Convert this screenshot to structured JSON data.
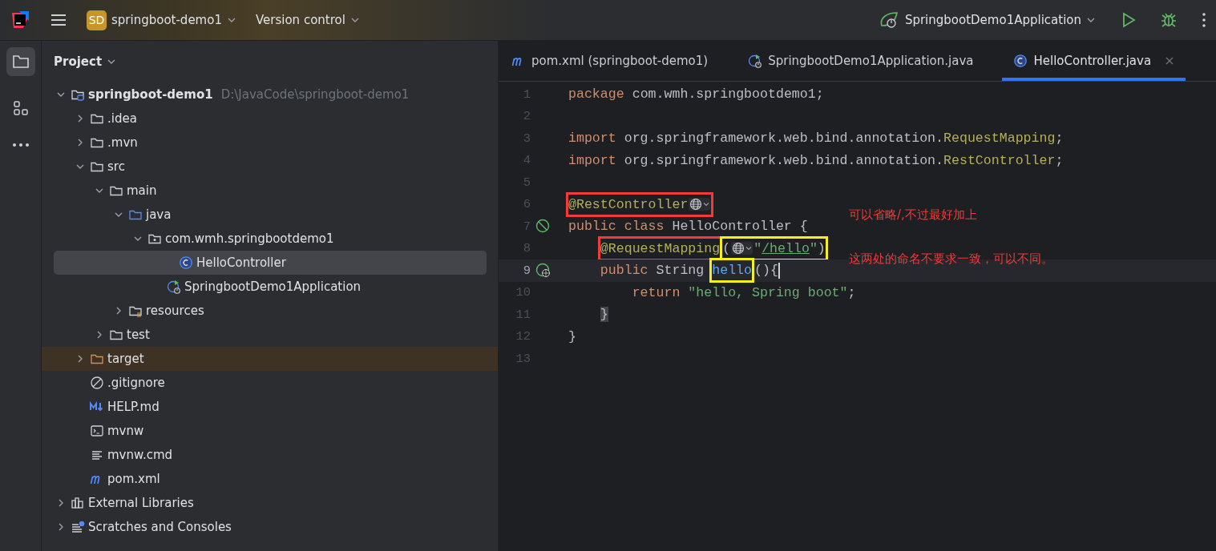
{
  "top_bar": {
    "project_badge": "SD",
    "project_name": "springboot-demo1",
    "version_control": "Version control",
    "run_config": "SpringbootDemo1Application"
  },
  "tool_strip": [
    {
      "kind": "project",
      "selected": true
    },
    {
      "kind": "structure",
      "selected": false
    },
    {
      "kind": "more",
      "selected": false
    }
  ],
  "project_panel": {
    "title": "Project",
    "tree": [
      {
        "label": "springboot-demo1",
        "path": "D:\\JavaCode\\springboot-demo1",
        "kind": "module",
        "expanded": true,
        "selected": false,
        "excluded": false,
        "children": [
          {
            "label": ".idea",
            "kind": "folder",
            "expanded": false,
            "selected": false,
            "excluded": false
          },
          {
            "label": ".mvn",
            "kind": "folder",
            "expanded": false,
            "selected": false,
            "excluded": false
          },
          {
            "label": "src",
            "kind": "folder",
            "expanded": true,
            "selected": false,
            "excluded": false,
            "children": [
              {
                "label": "main",
                "kind": "folder",
                "expanded": true,
                "selected": false,
                "excluded": false,
                "children": [
                  {
                    "label": "java",
                    "kind": "source",
                    "expanded": true,
                    "selected": false,
                    "excluded": false,
                    "children": [
                      {
                        "label": "com.wmh.springbootdemo1",
                        "kind": "package",
                        "expanded": true,
                        "selected": false,
                        "excluded": false,
                        "children": [
                          {
                            "label": "HelloController",
                            "kind": "class",
                            "selected": true,
                            "excluded": false
                          },
                          {
                            "label": "SpringbootDemo1Application",
                            "kind": "spring-app",
                            "selected": false,
                            "excluded": false
                          }
                        ]
                      }
                    ]
                  },
                  {
                    "label": "resources",
                    "kind": "resources",
                    "expanded": false,
                    "selected": false,
                    "excluded": false
                  }
                ]
              },
              {
                "label": "test",
                "kind": "folder",
                "expanded": false,
                "selected": false,
                "excluded": false
              }
            ]
          },
          {
            "label": "target",
            "kind": "excluded-folder",
            "expanded": false,
            "selected": false,
            "excluded": true
          },
          {
            "label": ".gitignore",
            "kind": "ignore",
            "selected": false,
            "excluded": false
          },
          {
            "label": "HELP.md",
            "kind": "markdown",
            "selected": false,
            "excluded": false
          },
          {
            "label": "mvnw",
            "kind": "script",
            "selected": false,
            "excluded": false
          },
          {
            "label": "mvnw.cmd",
            "kind": "text",
            "selected": false,
            "excluded": false
          },
          {
            "label": "pom.xml",
            "kind": "maven",
            "selected": false,
            "excluded": false
          }
        ]
      },
      {
        "label": "External Libraries",
        "kind": "libraries",
        "expanded": false,
        "selected": false,
        "excluded": false
      },
      {
        "label": "Scratches and Consoles",
        "kind": "scratches",
        "expanded": false,
        "selected": false,
        "excluded": false
      }
    ]
  },
  "tabs": [
    {
      "label": "pom.xml (springboot-demo1)",
      "kind": "maven",
      "selected": false
    },
    {
      "label": "SpringbootDemo1Application.java",
      "kind": "spring-app",
      "selected": false
    },
    {
      "label": "HelloController.java",
      "kind": "class",
      "selected": true
    }
  ],
  "code_lines": [
    {
      "number": "1",
      "current": false,
      "tokens": [
        {
          "kind": "keyword",
          "text": "package"
        },
        {
          "kind": "plain",
          "text": " com.wmh.springbootdemo1;"
        }
      ]
    },
    {
      "number": "2",
      "current": false
    },
    {
      "number": "3",
      "current": false,
      "tokens": [
        {
          "kind": "keyword",
          "text": "import"
        },
        {
          "kind": "plain",
          "text": " org.springframework.web.bind.annotation."
        },
        {
          "kind": "annotation",
          "text": "RequestMapping"
        },
        {
          "kind": "plain",
          "text": ";"
        }
      ]
    },
    {
      "number": "4",
      "current": false,
      "tokens": [
        {
          "kind": "keyword",
          "text": "import"
        },
        {
          "kind": "plain",
          "text": " org.springframework.web.bind.annotation."
        },
        {
          "kind": "annotation",
          "text": "RestController"
        },
        {
          "kind": "plain",
          "text": ";"
        }
      ]
    },
    {
      "number": "5",
      "current": false
    },
    {
      "number": "6",
      "current": false,
      "note": "可以省略/,不过最好加上",
      "tokens": [
        {
          "kind": "boxed",
          "color": "#f03b3b",
          "tokens": [
            {
              "kind": "annotation",
              "text": "@RestController"
            },
            {
              "kind": "inlay"
            }
          ]
        }
      ]
    },
    {
      "number": "7",
      "current": false,
      "gutter": {
        "kind": "bean"
      },
      "tokens": [
        {
          "kind": "keyword",
          "text": "public"
        },
        {
          "kind": "keyword",
          "text": " class"
        },
        {
          "kind": "plain",
          "text": " HelloController {"
        }
      ],
      "children": [
        {
          "number": "8",
          "current": false,
          "note": "这两处的命名不要求一致，可以不同。",
          "tokens": [
            {
              "kind": "boxed",
              "color": "#f03b3b",
              "tokens": [
                {
                  "kind": "annotation",
                  "text": "@RequestMapping"
                }
              ]
            },
            {
              "kind": "boxed",
              "color": "#f5f01a",
              "tokens": [
                {
                  "kind": "plain",
                  "text": "("
                },
                {
                  "kind": "inlay"
                },
                {
                  "kind": "string",
                  "text": "\""
                },
                {
                  "kind": "link",
                  "text": "/hello"
                },
                {
                  "kind": "string",
                  "text": "\""
                },
                {
                  "kind": "plain",
                  "text": ")"
                }
              ]
            }
          ]
        },
        {
          "number": "9",
          "current": true,
          "gutter": {
            "kind": "endpoint"
          },
          "tokens": [
            {
              "kind": "keyword",
              "text": "public"
            },
            {
              "kind": "plain",
              "text": " String "
            },
            {
              "kind": "boxed",
              "color": "#f5f01a",
              "tokens": [
                {
                  "kind": "method",
                  "text": "hello"
                }
              ]
            },
            {
              "kind": "plain",
              "text": "(){"
            }
          ],
          "children": [
            {
              "number": "10",
              "current": false,
              "tokens": [
                {
                  "kind": "keyword",
                  "text": "return"
                },
                {
                  "kind": "string",
                  "text": " \"hello, Spring boot\""
                },
                {
                  "kind": "plain",
                  "text": ";"
                }
              ]
            }
          ]
        },
        {
          "number": "11",
          "current": false,
          "tokens": [
            {
              "kind": "matched-brace",
              "text": "}"
            }
          ]
        }
      ]
    },
    {
      "number": "12",
      "current": false,
      "tokens": [
        {
          "kind": "plain",
          "text": "}"
        }
      ]
    },
    {
      "number": "13",
      "current": false
    }
  ]
}
